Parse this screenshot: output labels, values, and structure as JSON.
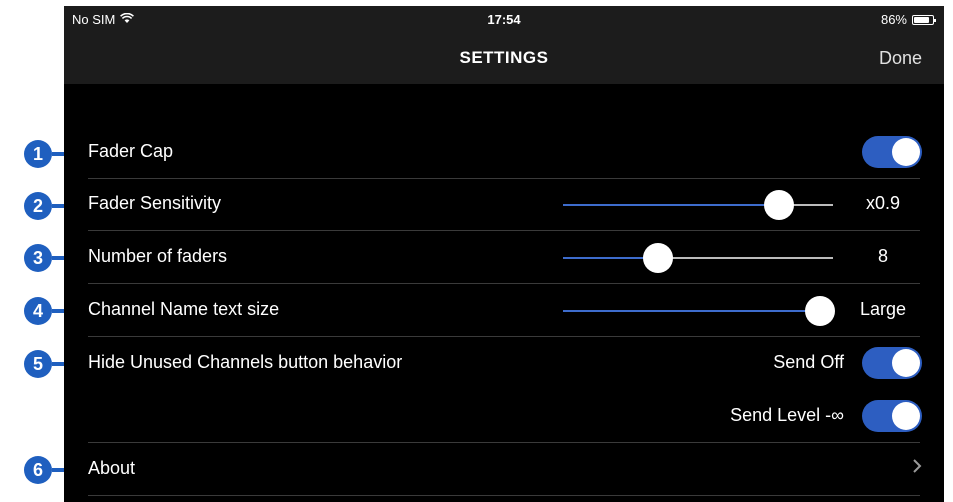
{
  "status_bar": {
    "carrier": "No SIM",
    "time": "17:54",
    "battery": "86%",
    "battery_level": 0.86
  },
  "nav": {
    "title": "SETTINGS",
    "done_label": "Done"
  },
  "settings": {
    "fader_cap": {
      "label": "Fader Cap",
      "on": true
    },
    "fader_sensitivity": {
      "label": "Fader Sensitivity",
      "value": "x0.9",
      "slider_position": 0.8
    },
    "number_of_faders": {
      "label": "Number of faders",
      "value": "8",
      "slider_position": 0.35
    },
    "channel_name_text_size": {
      "label": "Channel Name text size",
      "value": "Large",
      "slider_position": 0.95
    },
    "hide_unused": {
      "label": "Hide Unused Channels button behavior",
      "send_off_label": "Send Off",
      "send_off_on": true,
      "send_level_label": "Send Level -∞",
      "send_level_on": true
    },
    "about": {
      "label": "About"
    }
  },
  "callouts": [
    "1",
    "2",
    "3",
    "4",
    "5",
    "6"
  ],
  "colors": {
    "accent": "#2d5ec1",
    "callout": "#1f5fbf",
    "background": "#000000",
    "bar": "#1c1c1c"
  }
}
